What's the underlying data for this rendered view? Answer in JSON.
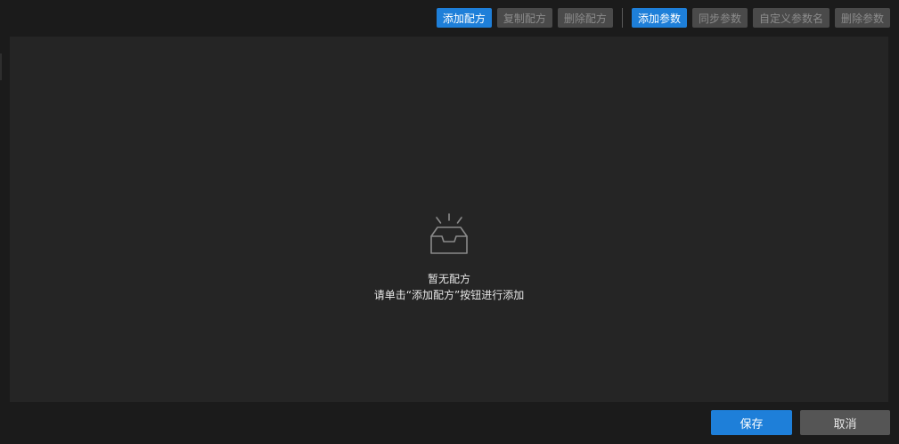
{
  "toolbar": {
    "recipe_buttons": [
      {
        "label": "添加配方",
        "state": "primary"
      },
      {
        "label": "复制配方",
        "state": "disabled"
      },
      {
        "label": "删除配方",
        "state": "disabled"
      }
    ],
    "param_buttons": [
      {
        "label": "添加参数",
        "state": "primary"
      },
      {
        "label": "同步参数",
        "state": "disabled"
      },
      {
        "label": "自定义参数名",
        "state": "disabled"
      },
      {
        "label": "删除参数",
        "state": "disabled"
      }
    ]
  },
  "empty_state": {
    "icon": "empty-inbox-icon",
    "title": "暂无配方",
    "hint": "请单击“添加配方”按钮进行添加"
  },
  "footer": {
    "save_label": "保存",
    "cancel_label": "取消"
  },
  "colors": {
    "accent": "#1e7fd9",
    "background": "#1b1b1b",
    "panel": "#252525",
    "disabled_button": "#4a4a4a",
    "disabled_text": "#8c8c8c"
  }
}
